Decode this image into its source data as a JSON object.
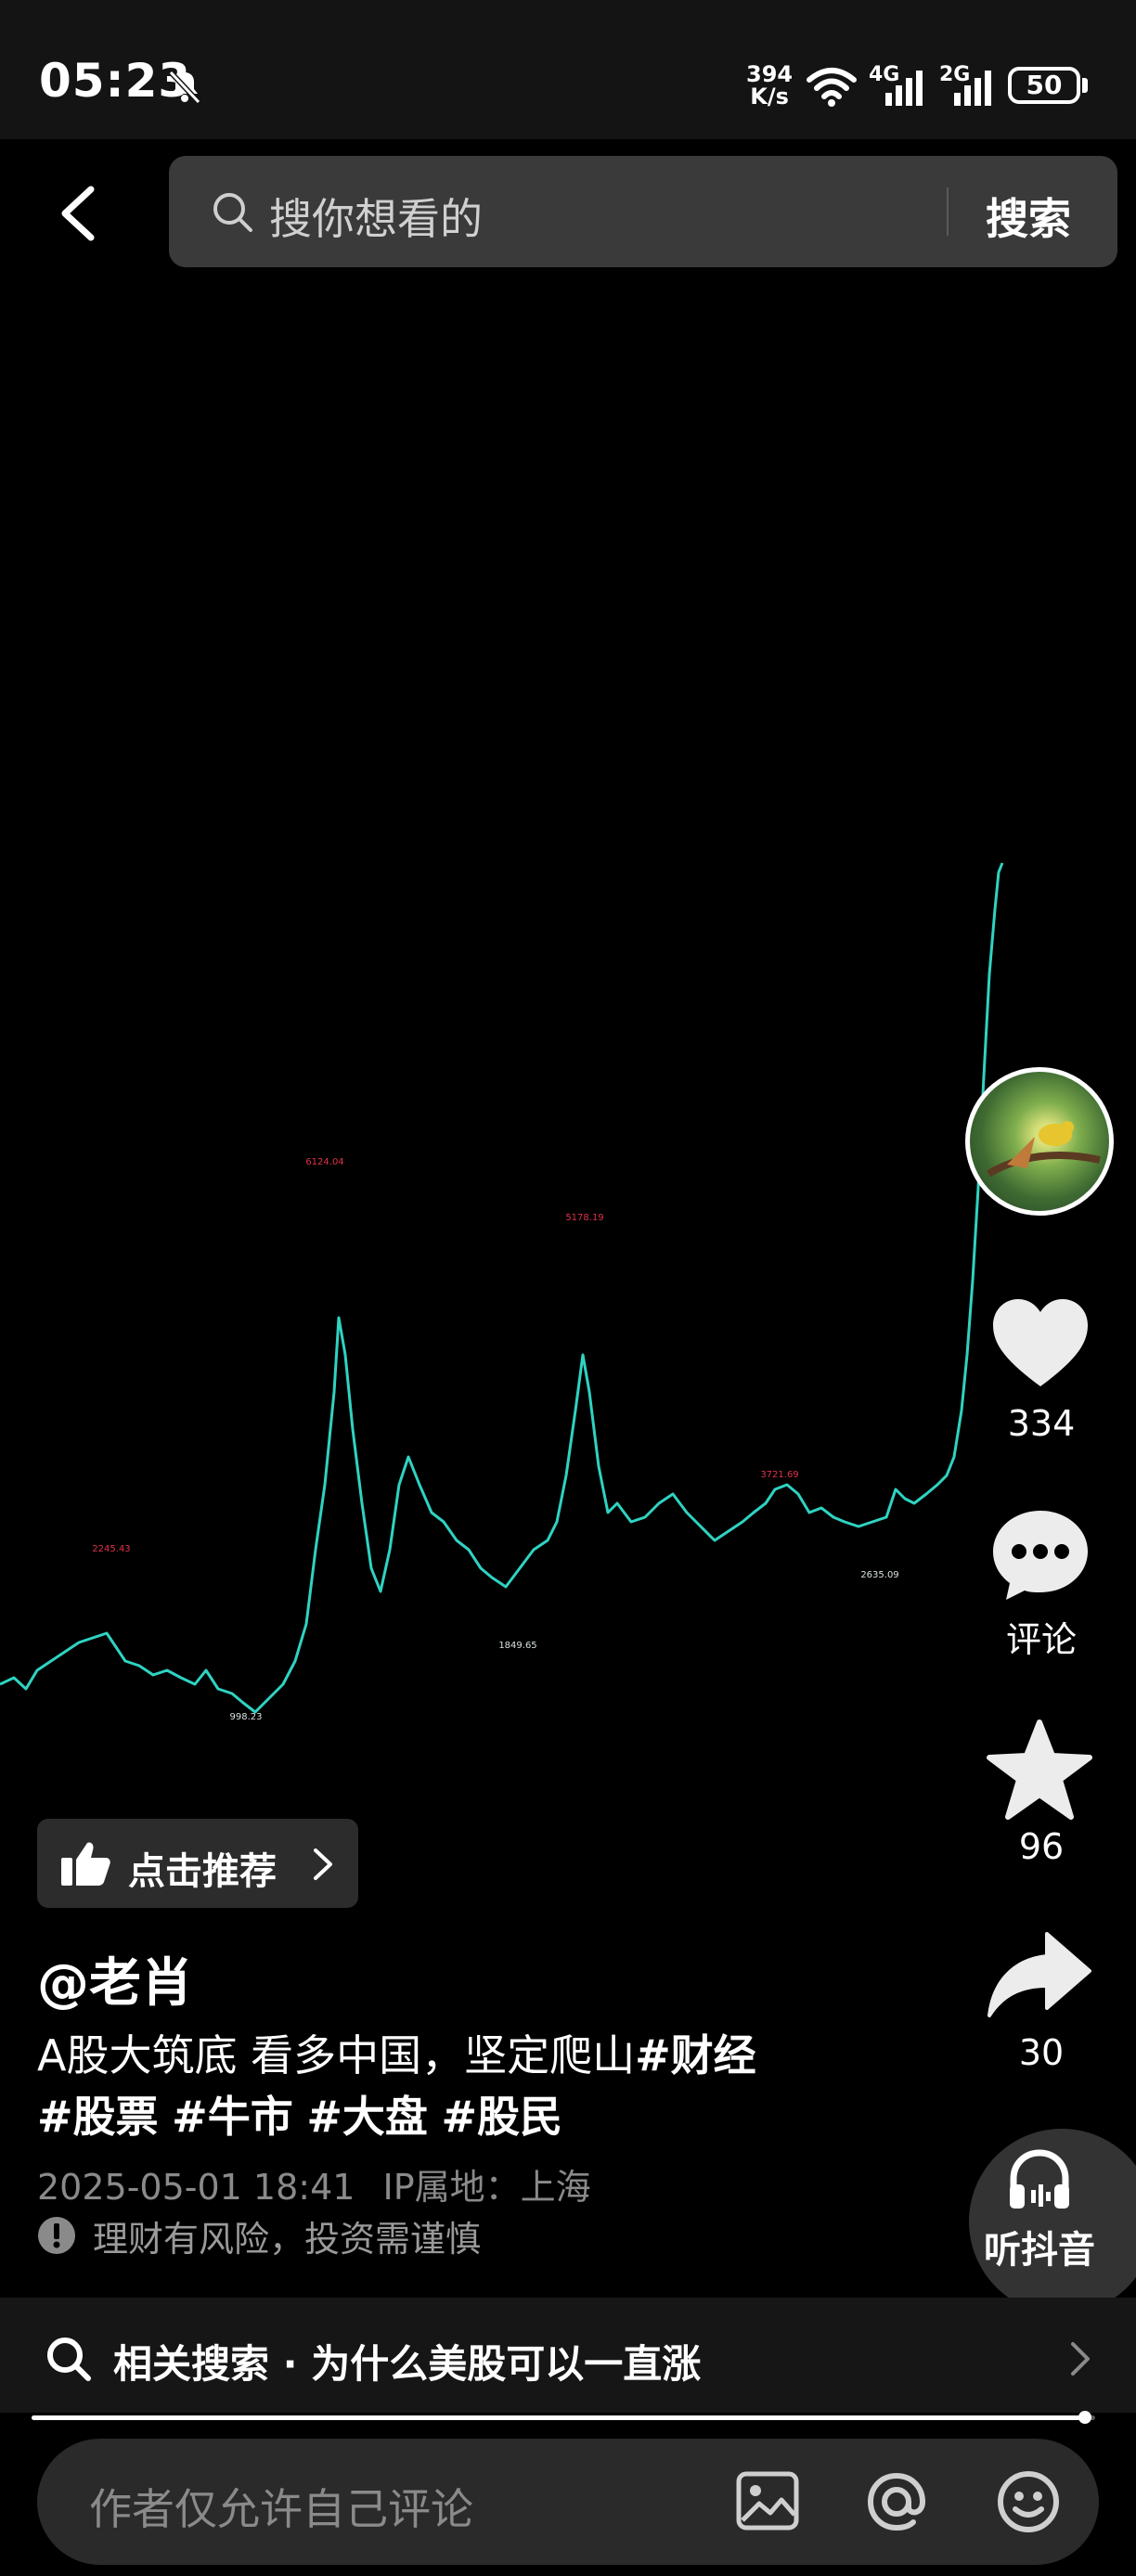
{
  "status_bar": {
    "time": "05:23",
    "net_speed_value": "394",
    "net_speed_unit": "K/s",
    "sim1": "4G",
    "sim2": "2G",
    "battery": "50"
  },
  "search": {
    "placeholder": "搜你想看的",
    "button": "搜索"
  },
  "chart_data": {
    "type": "line",
    "title": "",
    "annotations": [
      "6124.04",
      "5178.19",
      "3721.69",
      "2245.43",
      "998.23",
      "1849.65",
      "2635.09"
    ]
  },
  "actions": {
    "likes": "334",
    "comments_label": "评论",
    "favorites": "96",
    "shares": "30",
    "listen_label": "听抖音"
  },
  "post": {
    "recommend_label": "点击推荐",
    "author": "@老肖",
    "caption_text": "A股大筑底 看多中国，坚定爬山",
    "caption_tags": [
      "#财经",
      "#股票",
      "#牛市",
      "#大盘",
      "#股民"
    ],
    "date": "2025-05-01 18:41",
    "ip_location": "IP属地：上海",
    "risk_notice": "理财有风险，投资需谨慎"
  },
  "related_search": "相关搜索 · 为什么美股可以一直涨",
  "video_progress": 0.99,
  "comment_input": {
    "placeholder": "作者仅允许自己评论"
  },
  "colors": {
    "chart_line": "#2fd3c2",
    "chart_label": "#e0324b",
    "background": "#000000"
  }
}
